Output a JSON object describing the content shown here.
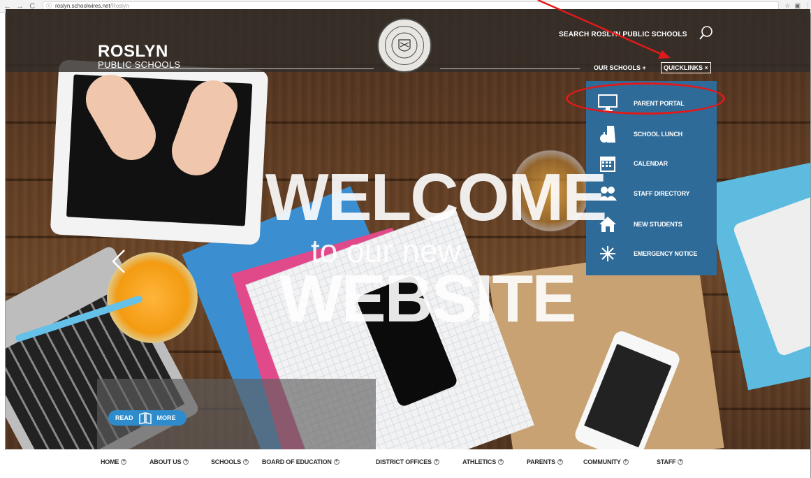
{
  "browser": {
    "url_host": "roslyn.schoolwires.net",
    "url_path": "/Roslyn"
  },
  "header": {
    "brand_line1": "ROSLYN",
    "brand_line2": "PUBLIC SCHOOLS",
    "search_label": "SEARCH ROSLYN PUBLIC SCHOOLS",
    "our_schools": "OUR SCHOOLS +",
    "quicklinks": "QUICKLINKS ×"
  },
  "quicklinks": [
    {
      "label": "PARENT PORTAL",
      "icon": "monitor-icon"
    },
    {
      "label": "SCHOOL LUNCH",
      "icon": "lunch-icon"
    },
    {
      "label": "CALENDAR",
      "icon": "calendar-icon"
    },
    {
      "label": "STAFF DIRECTORY",
      "icon": "people-icon"
    },
    {
      "label": "NEW STUDENTS",
      "icon": "house-icon"
    },
    {
      "label": "EMERGENCY NOTICE",
      "icon": "snowflake-icon"
    }
  ],
  "hero": {
    "line1": "WELCOME",
    "line2": "to our new",
    "line3": "WEBSITE",
    "read": "READ",
    "more": "MORE"
  },
  "bottom_nav": [
    {
      "label": "HOME"
    },
    {
      "label": "ABOUT US"
    },
    {
      "label": "SCHOOLS"
    },
    {
      "label": "BOARD OF EDUCATION"
    },
    {
      "label": "DISTRICT OFFICES"
    },
    {
      "label": "ATHLETICS"
    },
    {
      "label": "PARENTS"
    },
    {
      "label": "COMMUNITY"
    },
    {
      "label": "STAFF"
    }
  ],
  "colors": {
    "menu_bg": "#2f6b99",
    "annotation": "#e01a1a",
    "read_more": "#2f8ccc"
  }
}
